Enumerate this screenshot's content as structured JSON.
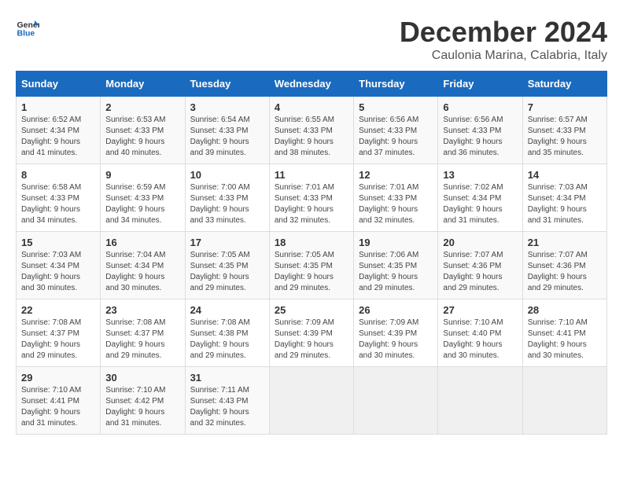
{
  "logo": {
    "line1": "General",
    "line2": "Blue"
  },
  "title": "December 2024",
  "subtitle": "Caulonia Marina, Calabria, Italy",
  "weekdays": [
    "Sunday",
    "Monday",
    "Tuesday",
    "Wednesday",
    "Thursday",
    "Friday",
    "Saturday"
  ],
  "rows": [
    [
      {
        "day": "1",
        "sunrise": "6:52 AM",
        "sunset": "4:34 PM",
        "daylight": "9 hours and 41 minutes."
      },
      {
        "day": "2",
        "sunrise": "6:53 AM",
        "sunset": "4:33 PM",
        "daylight": "9 hours and 40 minutes."
      },
      {
        "day": "3",
        "sunrise": "6:54 AM",
        "sunset": "4:33 PM",
        "daylight": "9 hours and 39 minutes."
      },
      {
        "day": "4",
        "sunrise": "6:55 AM",
        "sunset": "4:33 PM",
        "daylight": "9 hours and 38 minutes."
      },
      {
        "day": "5",
        "sunrise": "6:56 AM",
        "sunset": "4:33 PM",
        "daylight": "9 hours and 37 minutes."
      },
      {
        "day": "6",
        "sunrise": "6:56 AM",
        "sunset": "4:33 PM",
        "daylight": "9 hours and 36 minutes."
      },
      {
        "day": "7",
        "sunrise": "6:57 AM",
        "sunset": "4:33 PM",
        "daylight": "9 hours and 35 minutes."
      }
    ],
    [
      {
        "day": "8",
        "sunrise": "6:58 AM",
        "sunset": "4:33 PM",
        "daylight": "9 hours and 34 minutes."
      },
      {
        "day": "9",
        "sunrise": "6:59 AM",
        "sunset": "4:33 PM",
        "daylight": "9 hours and 34 minutes."
      },
      {
        "day": "10",
        "sunrise": "7:00 AM",
        "sunset": "4:33 PM",
        "daylight": "9 hours and 33 minutes."
      },
      {
        "day": "11",
        "sunrise": "7:01 AM",
        "sunset": "4:33 PM",
        "daylight": "9 hours and 32 minutes."
      },
      {
        "day": "12",
        "sunrise": "7:01 AM",
        "sunset": "4:33 PM",
        "daylight": "9 hours and 32 minutes."
      },
      {
        "day": "13",
        "sunrise": "7:02 AM",
        "sunset": "4:34 PM",
        "daylight": "9 hours and 31 minutes."
      },
      {
        "day": "14",
        "sunrise": "7:03 AM",
        "sunset": "4:34 PM",
        "daylight": "9 hours and 31 minutes."
      }
    ],
    [
      {
        "day": "15",
        "sunrise": "7:03 AM",
        "sunset": "4:34 PM",
        "daylight": "9 hours and 30 minutes."
      },
      {
        "day": "16",
        "sunrise": "7:04 AM",
        "sunset": "4:34 PM",
        "daylight": "9 hours and 30 minutes."
      },
      {
        "day": "17",
        "sunrise": "7:05 AM",
        "sunset": "4:35 PM",
        "daylight": "9 hours and 29 minutes."
      },
      {
        "day": "18",
        "sunrise": "7:05 AM",
        "sunset": "4:35 PM",
        "daylight": "9 hours and 29 minutes."
      },
      {
        "day": "19",
        "sunrise": "7:06 AM",
        "sunset": "4:35 PM",
        "daylight": "9 hours and 29 minutes."
      },
      {
        "day": "20",
        "sunrise": "7:07 AM",
        "sunset": "4:36 PM",
        "daylight": "9 hours and 29 minutes."
      },
      {
        "day": "21",
        "sunrise": "7:07 AM",
        "sunset": "4:36 PM",
        "daylight": "9 hours and 29 minutes."
      }
    ],
    [
      {
        "day": "22",
        "sunrise": "7:08 AM",
        "sunset": "4:37 PM",
        "daylight": "9 hours and 29 minutes."
      },
      {
        "day": "23",
        "sunrise": "7:08 AM",
        "sunset": "4:37 PM",
        "daylight": "9 hours and 29 minutes."
      },
      {
        "day": "24",
        "sunrise": "7:08 AM",
        "sunset": "4:38 PM",
        "daylight": "9 hours and 29 minutes."
      },
      {
        "day": "25",
        "sunrise": "7:09 AM",
        "sunset": "4:39 PM",
        "daylight": "9 hours and 29 minutes."
      },
      {
        "day": "26",
        "sunrise": "7:09 AM",
        "sunset": "4:39 PM",
        "daylight": "9 hours and 30 minutes."
      },
      {
        "day": "27",
        "sunrise": "7:10 AM",
        "sunset": "4:40 PM",
        "daylight": "9 hours and 30 minutes."
      },
      {
        "day": "28",
        "sunrise": "7:10 AM",
        "sunset": "4:41 PM",
        "daylight": "9 hours and 30 minutes."
      }
    ],
    [
      {
        "day": "29",
        "sunrise": "7:10 AM",
        "sunset": "4:41 PM",
        "daylight": "9 hours and 31 minutes."
      },
      {
        "day": "30",
        "sunrise": "7:10 AM",
        "sunset": "4:42 PM",
        "daylight": "9 hours and 31 minutes."
      },
      {
        "day": "31",
        "sunrise": "7:11 AM",
        "sunset": "4:43 PM",
        "daylight": "9 hours and 32 minutes."
      },
      null,
      null,
      null,
      null
    ]
  ],
  "labels": {
    "sunrise": "Sunrise:",
    "sunset": "Sunset:",
    "daylight": "Daylight:"
  }
}
